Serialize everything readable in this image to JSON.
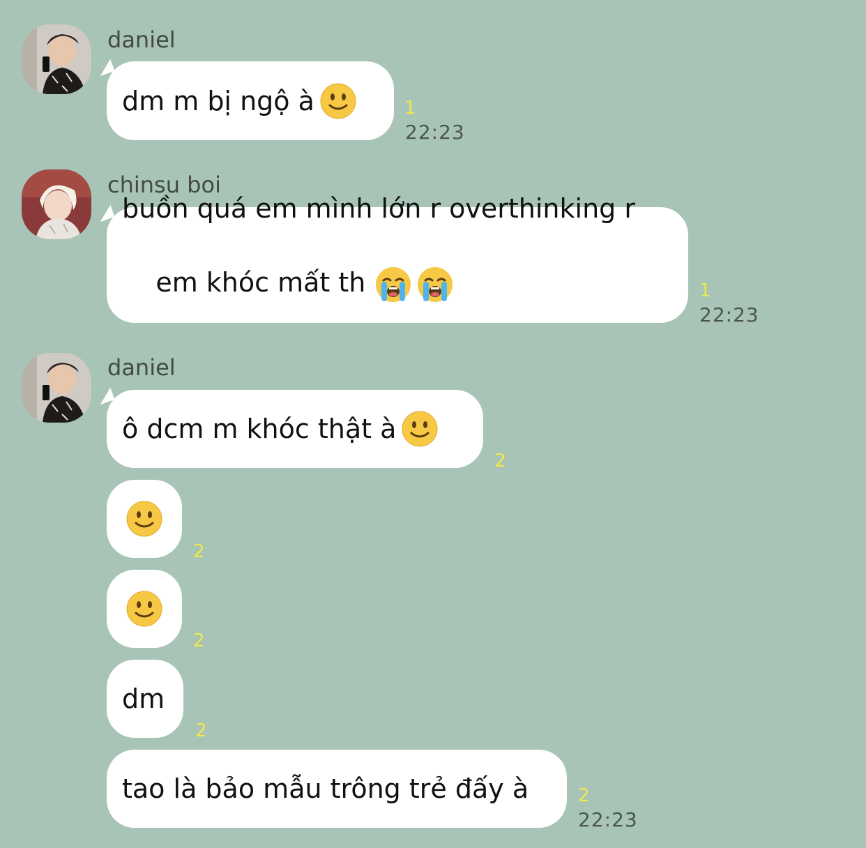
{
  "messages": [
    {
      "sender": "daniel",
      "text": "dm m bị ngộ à",
      "emojis": [
        "slight-smile-emoji"
      ],
      "read_count": "1",
      "time": "22:23"
    },
    {
      "sender": "chinsu boi",
      "line1": "buồn quá em mình lớn r overthinking r",
      "line2": "em khóc mất th",
      "emojis": [
        "loudly-crying-emoji",
        "loudly-crying-emoji"
      ],
      "read_count": "1",
      "time": "22:23"
    },
    {
      "sender": "daniel",
      "text": "ô dcm m khóc thật à",
      "emojis": [
        "slight-smile-emoji"
      ],
      "read_count": "2"
    },
    {
      "emojis": [
        "slight-smile-emoji"
      ],
      "read_count": "2"
    },
    {
      "emojis": [
        "slight-smile-emoji"
      ],
      "read_count": "2"
    },
    {
      "text": "dm",
      "read_count": "2"
    },
    {
      "text": "tao là bảo mẫu trông trẻ đấy à",
      "read_count": "2",
      "time": "22:23"
    }
  ],
  "colors": {
    "background": "#a7c4b7",
    "bubble": "#ffffff",
    "read_count": "#f2e94a",
    "time": "#4d5551",
    "sender": "#444a47"
  }
}
